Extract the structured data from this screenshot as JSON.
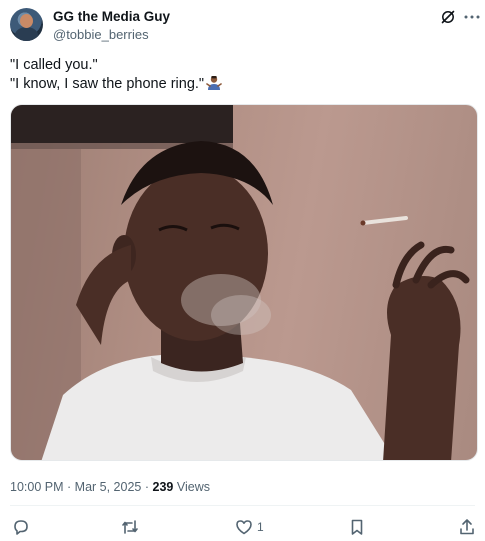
{
  "author": {
    "display_name": "GG the Media Guy",
    "handle": "@tobbie_berries"
  },
  "icons": {
    "header": [
      "grok-icon",
      "more-icon"
    ],
    "emoji": "person-shrugging-emoji",
    "actions": [
      "reply-icon",
      "retweet-icon",
      "like-icon",
      "bookmark-icon",
      "share-icon"
    ]
  },
  "tweet": {
    "lines": [
      "\"I called you.\"",
      "\"I know, I saw the phone ring.\""
    ]
  },
  "media": {
    "description": "Photo of a man in a white t-shirt exhaling smoke while holding a cigarette"
  },
  "meta": {
    "time": "10:00 PM",
    "separator": "·",
    "date": "Mar 5, 2025",
    "views_count": "239",
    "views_label": "Views"
  },
  "actions": {
    "reply_count": "",
    "retweet_count": "",
    "like_count": "1"
  },
  "colors": {
    "text": "#0f1419",
    "secondary": "#536471",
    "divider": "#eff3f4"
  }
}
